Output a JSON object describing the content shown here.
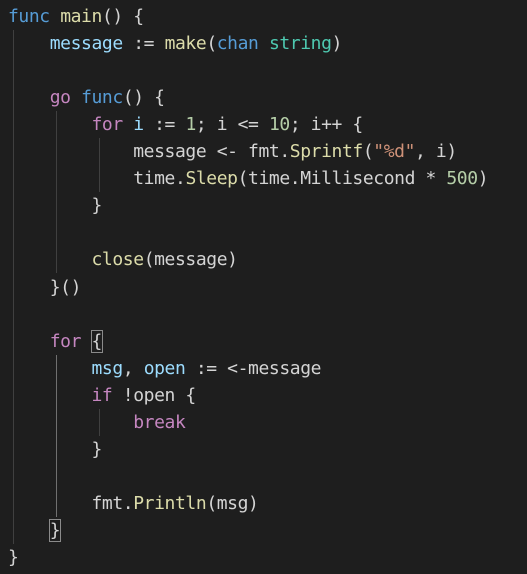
{
  "editor": {
    "language": "go",
    "theme": "dark",
    "colors": {
      "background": "#1e1e1e",
      "keyword": "#569cd6",
      "control": "#c586c0",
      "function": "#dcdcaa",
      "type": "#4ec9b0",
      "number": "#b5cea8",
      "string": "#ce9178",
      "variable": "#9cdcfe",
      "text": "#d4d4d4"
    },
    "lines": [
      [
        {
          "t": "kw",
          "v": "func"
        },
        {
          "t": "plain",
          "v": " "
        },
        {
          "t": "fn",
          "v": "main"
        },
        {
          "t": "plain",
          "v": "() {"
        }
      ],
      [
        {
          "t": "plain",
          "v": "    "
        },
        {
          "t": "var",
          "v": "message"
        },
        {
          "t": "plain",
          "v": " := "
        },
        {
          "t": "fn",
          "v": "make"
        },
        {
          "t": "plain",
          "v": "("
        },
        {
          "t": "kw",
          "v": "chan"
        },
        {
          "t": "plain",
          "v": " "
        },
        {
          "t": "ty",
          "v": "string"
        },
        {
          "t": "plain",
          "v": ")"
        }
      ],
      [],
      [
        {
          "t": "plain",
          "v": "    "
        },
        {
          "t": "ctl",
          "v": "go"
        },
        {
          "t": "plain",
          "v": " "
        },
        {
          "t": "kw",
          "v": "func"
        },
        {
          "t": "plain",
          "v": "() {"
        }
      ],
      [
        {
          "t": "plain",
          "v": "        "
        },
        {
          "t": "ctl",
          "v": "for"
        },
        {
          "t": "plain",
          "v": " "
        },
        {
          "t": "var",
          "v": "i"
        },
        {
          "t": "plain",
          "v": " := "
        },
        {
          "t": "num",
          "v": "1"
        },
        {
          "t": "plain",
          "v": "; i <= "
        },
        {
          "t": "num",
          "v": "10"
        },
        {
          "t": "plain",
          "v": "; i++ {"
        }
      ],
      [
        {
          "t": "plain",
          "v": "            message <- fmt."
        },
        {
          "t": "fn",
          "v": "Sprintf"
        },
        {
          "t": "plain",
          "v": "("
        },
        {
          "t": "str",
          "v": "\"%d\""
        },
        {
          "t": "plain",
          "v": ", i)"
        }
      ],
      [
        {
          "t": "plain",
          "v": "            time."
        },
        {
          "t": "fn",
          "v": "Sleep"
        },
        {
          "t": "plain",
          "v": "(time.Millisecond * "
        },
        {
          "t": "num",
          "v": "500"
        },
        {
          "t": "plain",
          "v": ")"
        }
      ],
      [
        {
          "t": "plain",
          "v": "        }"
        }
      ],
      [],
      [
        {
          "t": "plain",
          "v": "        "
        },
        {
          "t": "fn",
          "v": "close"
        },
        {
          "t": "plain",
          "v": "(message)"
        }
      ],
      [
        {
          "t": "plain",
          "v": "    }()"
        }
      ],
      [],
      [
        {
          "t": "plain",
          "v": "    "
        },
        {
          "t": "ctl",
          "v": "for"
        },
        {
          "t": "plain",
          "v": " "
        },
        {
          "t": "hl",
          "v": "{"
        }
      ],
      [
        {
          "t": "plain",
          "v": "        "
        },
        {
          "t": "var",
          "v": "msg"
        },
        {
          "t": "plain",
          "v": ", "
        },
        {
          "t": "var",
          "v": "open"
        },
        {
          "t": "plain",
          "v": " := <-message"
        }
      ],
      [
        {
          "t": "plain",
          "v": "        "
        },
        {
          "t": "ctl",
          "v": "if"
        },
        {
          "t": "plain",
          "v": " !open {"
        }
      ],
      [
        {
          "t": "plain",
          "v": "            "
        },
        {
          "t": "ctl",
          "v": "break"
        }
      ],
      [
        {
          "t": "plain",
          "v": "        }"
        }
      ],
      [],
      [
        {
          "t": "plain",
          "v": "        fmt."
        },
        {
          "t": "fn",
          "v": "Println"
        },
        {
          "t": "plain",
          "v": "(msg)"
        }
      ],
      [
        {
          "t": "plain",
          "v": "    "
        },
        {
          "t": "hl",
          "v": "}"
        }
      ],
      [
        {
          "t": "plain",
          "v": "}"
        }
      ]
    ]
  }
}
